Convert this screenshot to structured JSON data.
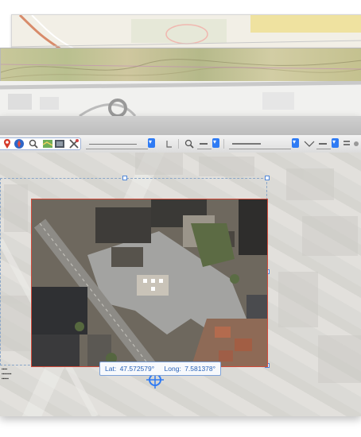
{
  "status": {
    "lat_label": "Lat:",
    "lat_value": "47.572579°",
    "long_label": "Long:",
    "long_value": "7.581378°"
  },
  "icons": {
    "toolbar": [
      "map-pin-icon",
      "compass-icon",
      "search-icon",
      "map-icon",
      "photo-icon",
      "tools-icon",
      "rotate-icon",
      "zoom-icon",
      "line-icon",
      "layers-icon",
      "view-icon"
    ]
  },
  "colors": {
    "accent": "#2f7bf4",
    "selection": "#d24a3a",
    "coordinate_text": "#2862b8"
  }
}
